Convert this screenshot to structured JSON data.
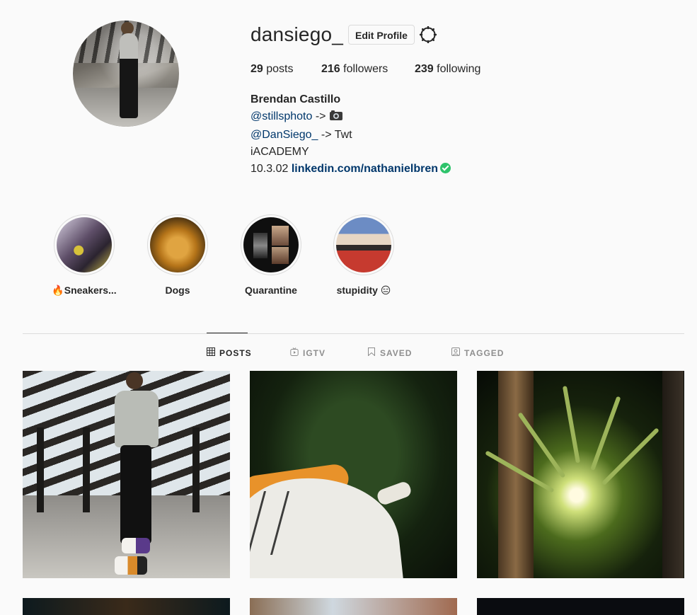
{
  "profile": {
    "username": "dansiego_",
    "edit_label": "Edit Profile",
    "stats": {
      "posts_count": "29",
      "posts_label": "posts",
      "followers_count": "216",
      "followers_label": "followers",
      "following_count": "239",
      "following_label": "following"
    },
    "bio": {
      "full_name": "Brendan Castillo",
      "line1_handle": "@stillsphoto",
      "line1_arrow": "->",
      "line2_handle": "@DanSiego_",
      "line2_rest": "-> Twt",
      "line3": "iACADEMY",
      "line4_date": "10.3.02",
      "link": "linkedin.com/nathanielbren"
    }
  },
  "highlights": [
    {
      "label": "🔥Sneakers..."
    },
    {
      "label": "Dogs"
    },
    {
      "label": "Quarantine"
    },
    {
      "label": "stupidity 😑"
    }
  ],
  "tabs": [
    {
      "label": "POSTS",
      "icon": "grid-icon",
      "active": true
    },
    {
      "label": "IGTV",
      "icon": "igtv-icon",
      "active": false
    },
    {
      "label": "SAVED",
      "icon": "bookmark-icon",
      "active": false
    },
    {
      "label": "TAGGED",
      "icon": "tagged-icon",
      "active": false
    }
  ],
  "colors": {
    "link": "#00376b",
    "verified": "#2ec36b",
    "muted": "#8e8e8e",
    "text": "#262626",
    "background": "#fafafa",
    "border": "#dbdbdb"
  }
}
